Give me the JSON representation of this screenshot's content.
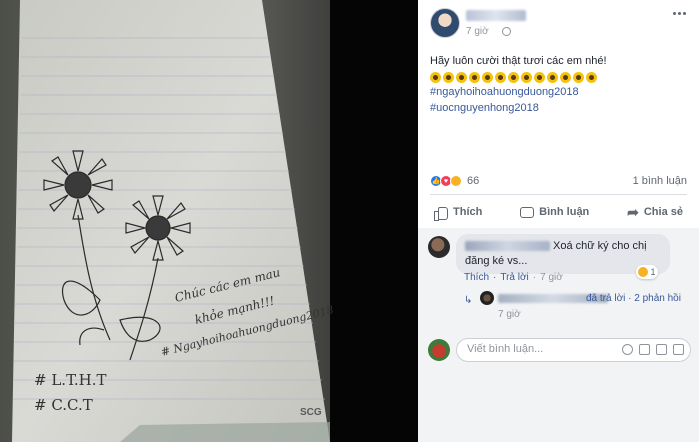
{
  "post": {
    "time": "7 giờ",
    "text": "Hãy luôn cười thật tươi các em nhé!",
    "emoji_count": 13,
    "hashtags": [
      "#ngayhoihoahuongduong2018",
      "#uocnguyenhong2018"
    ],
    "reaction_count": "66",
    "comment_count": "1 bình luận",
    "actions": {
      "like": "Thích",
      "comment": "Bình luận",
      "share": "Chia sẻ"
    }
  },
  "photo": {
    "note_line1": "Chúc các em mau",
    "note_line2": "khỏe mạnh!!!",
    "note_line3": "# Ngayhoihoahuongduong2018",
    "tag1": "# L.T.H.T",
    "tag2": "# C.C.T",
    "brand": "SCG"
  },
  "comment": {
    "text": "Xoá chữ ký cho chị đăng ké vs...",
    "haha_count": "1",
    "like_label": "Thích",
    "reply_label": "Trả lời",
    "time": "7 giờ",
    "reply_summary": "đã trả lời · 2 phản hồi",
    "reply_time": "7 giờ"
  },
  "input": {
    "placeholder": "Viết bình luận..."
  },
  "colors": {
    "link": "#385898",
    "like": "#2078f4",
    "love": "#f33e58",
    "haha": "#f7b125"
  }
}
